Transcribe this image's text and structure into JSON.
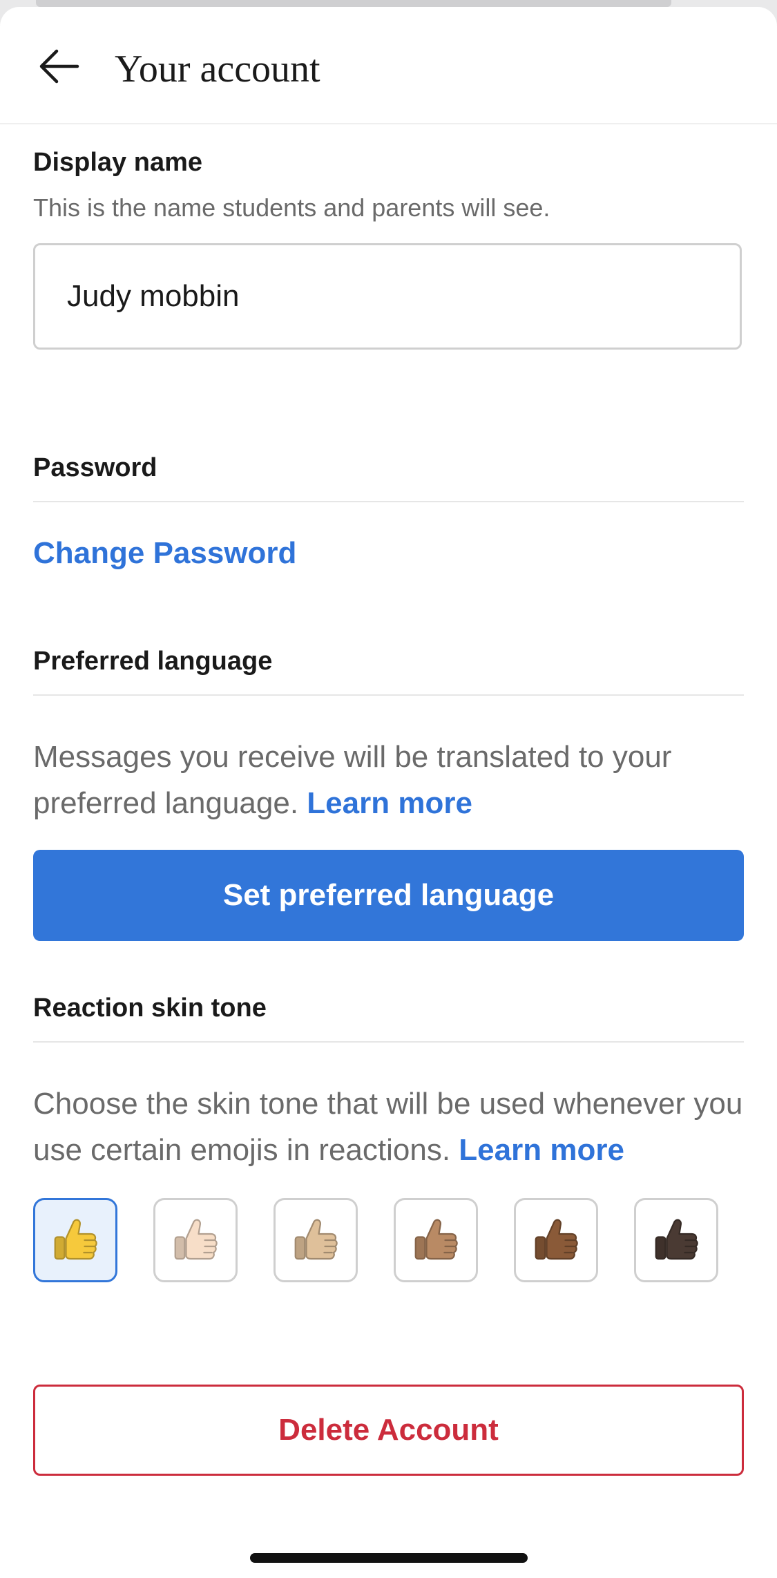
{
  "header": {
    "title": "Your account",
    "back_icon": "arrow-left-icon"
  },
  "display_name": {
    "label": "Display name",
    "helper": "This is the name students and parents will see.",
    "value": "Judy mobbin"
  },
  "password": {
    "label": "Password",
    "change_link": "Change Password"
  },
  "language": {
    "label": "Preferred language",
    "description": "Messages you receive will be translated to your preferred language.",
    "learn_more": "Learn more",
    "button": "Set preferred language"
  },
  "skin_tone": {
    "label": "Reaction skin tone",
    "description": "Choose the skin tone that will be used whenever you use certain emojis in reactions.",
    "learn_more": "Learn more",
    "selected_index": 0,
    "tones": [
      {
        "icon": "thumbs-up-default-icon",
        "color": "#F6C93C"
      },
      {
        "icon": "thumbs-up-light-icon",
        "color": "#F7DEC8"
      },
      {
        "icon": "thumbs-up-medium-light-icon",
        "color": "#DFC09A"
      },
      {
        "icon": "thumbs-up-medium-icon",
        "color": "#B98A64"
      },
      {
        "icon": "thumbs-up-medium-dark-icon",
        "color": "#8A5A38"
      },
      {
        "icon": "thumbs-up-dark-icon",
        "color": "#4A3A33"
      }
    ]
  },
  "delete": {
    "button": "Delete Account"
  },
  "colors": {
    "accent": "#3276D9",
    "danger": "#CC2C3C",
    "secondary_text": "#6A6A6A"
  }
}
